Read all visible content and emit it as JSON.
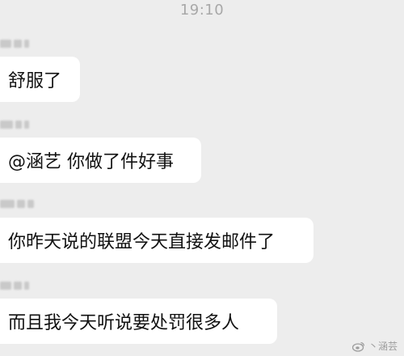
{
  "status_bar": {
    "time": "19:10"
  },
  "messages": [
    {
      "text": "舒服了"
    },
    {
      "text": "@涵艺 你做了件好事"
    },
    {
      "text": "你昨天说的联盟今天直接发邮件了"
    },
    {
      "text": "而且我今天听说要处罚很多人"
    }
  ],
  "watermark": {
    "text": "丶涵芸",
    "icon": "weibo-logo-icon"
  },
  "colors": {
    "background": "#ededed",
    "bubble": "#ffffff",
    "text": "#111111",
    "timestamp": "#a8a8a8"
  }
}
